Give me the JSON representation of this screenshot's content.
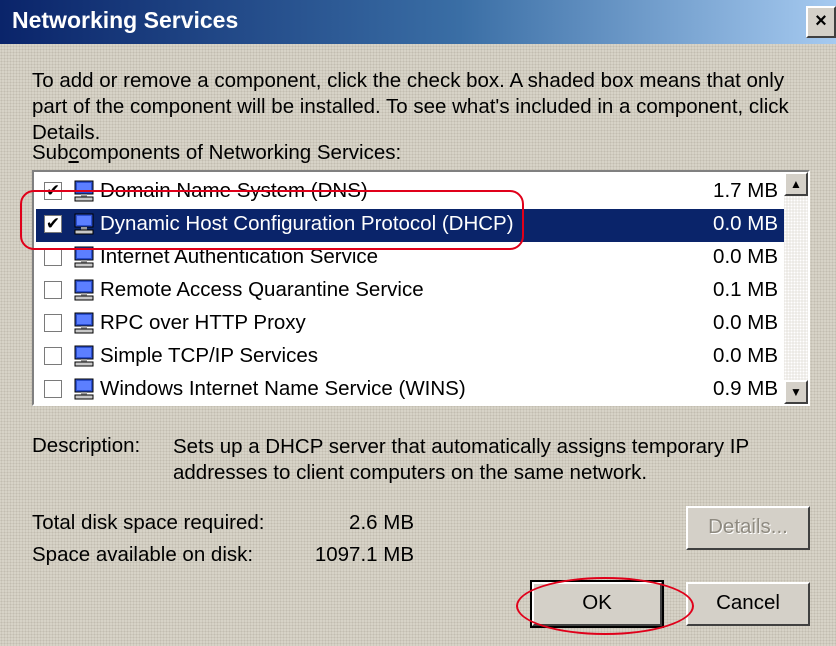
{
  "window": {
    "title": "Networking Services",
    "close_glyph": "×"
  },
  "intro_text": "To add or remove a component, click the check box. A shaded box means that only part of the component will be installed. To see what's included in a component, click Details.",
  "list_label_pre": "Sub",
  "list_label_accel": "c",
  "list_label_post": "omponents of Networking Services:",
  "components": [
    {
      "label": "Domain Name System (DNS)",
      "size": "1.7 MB",
      "checked": "✔"
    },
    {
      "label": "Dynamic Host Configuration Protocol (DHCP)",
      "size": "0.0 MB",
      "checked": "✔"
    },
    {
      "label": "Internet Authentication Service",
      "size": "0.0 MB",
      "checked": ""
    },
    {
      "label": "Remote Access Quarantine Service",
      "size": "0.1 MB",
      "checked": ""
    },
    {
      "label": "RPC over HTTP Proxy",
      "size": "0.0 MB",
      "checked": ""
    },
    {
      "label": "Simple TCP/IP Services",
      "size": "0.0 MB",
      "checked": ""
    },
    {
      "label": "Windows Internet Name Service (WINS)",
      "size": "0.9 MB",
      "checked": ""
    }
  ],
  "selected_index": 1,
  "description": {
    "label": "Description:",
    "text": "Sets up a DHCP server that automatically assigns temporary IP addresses to client computers on the same network."
  },
  "disk": {
    "required_label": "Total disk space required:",
    "required_value": "2.6 MB",
    "available_label": "Space available on disk:",
    "available_value": "1097.1 MB"
  },
  "buttons": {
    "details": "Details...",
    "ok": "OK",
    "cancel": "Cancel"
  },
  "scroll": {
    "up_glyph": "▲",
    "down_glyph": "▼"
  },
  "colors": {
    "annotation": "#e0001a",
    "selection": "#0a246a"
  },
  "icons": {
    "component": "network-computer-icon"
  }
}
